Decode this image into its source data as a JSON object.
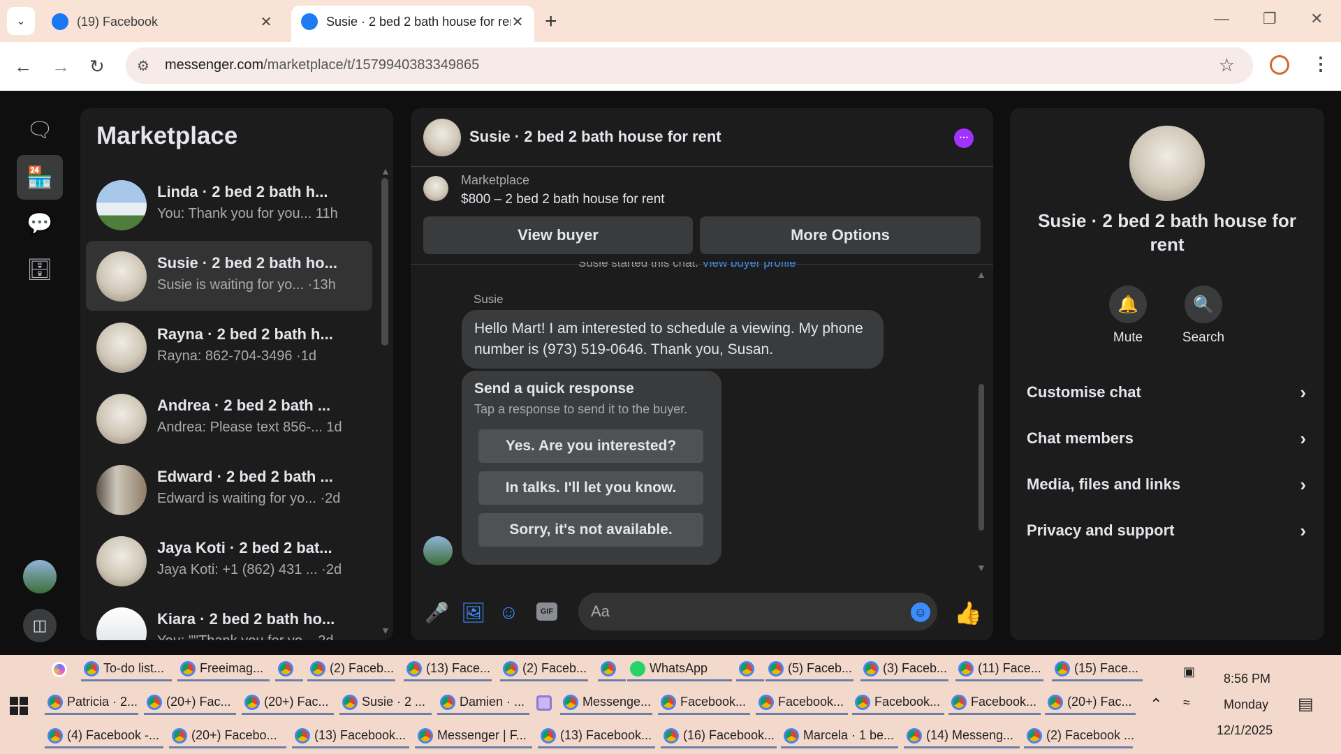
{
  "browser": {
    "tabs": [
      {
        "label": "(19) Facebook",
        "active": false
      },
      {
        "label": "Susie · 2 bed 2 bath house for rent",
        "active": true
      }
    ],
    "new_tab": "+",
    "url_domain": "messenger.com",
    "url_path": "/marketplace/t/1579940383349865"
  },
  "left": {
    "title": "Marketplace",
    "conversations": [
      {
        "name": "Linda · 2 bed 2 bath h...",
        "preview": "You: Thank you for you...",
        "time": "11h"
      },
      {
        "name": "Susie · 2 bed 2 bath ho...",
        "preview": "Susie is waiting for yo...",
        "time": "·13h"
      },
      {
        "name": "Rayna · 2 bed 2 bath h...",
        "preview": "Rayna: 862-704-3496",
        "time": "·1d"
      },
      {
        "name": "Andrea · 2 bed 2 bath ...",
        "preview": "Andrea: Please text 856-...",
        "time": "1d"
      },
      {
        "name": "Edward · 2 bed 2 bath ...",
        "preview": "Edward is waiting for yo...",
        "time": "·2d"
      },
      {
        "name": "Jaya Koti · 2 bed 2 bat...",
        "preview": "Jaya Koti: +1 (862) 431 ...",
        "time": "·2d"
      },
      {
        "name": "Kiara · 2 bed 2 bath ho...",
        "preview": "You: \"\"Thank you for yo...",
        "time": "2d"
      }
    ]
  },
  "chat": {
    "title": "Susie · 2 bed 2 bath house for rent",
    "marketplace_label": "Marketplace",
    "listing": "$800 – 2 bed 2 bath house for rent",
    "view_buyer": "View buyer",
    "more_options": "More Options",
    "started_text": "Susie started this chat.",
    "started_link": "View buyer profile",
    "sender": "Susie",
    "message": "Hello Mart! I am interested to schedule a viewing. My phone number is (973) 519-0646. Thank you, Susan.",
    "quick_title": "Send a quick response",
    "quick_sub": "Tap a response to send it to the buyer.",
    "quick_replies": [
      "Yes. Are you interested?",
      "In talks. I'll let you know.",
      "Sorry, it's not available."
    ],
    "input_placeholder": "Aa"
  },
  "details": {
    "title": "Susie · 2 bed 2 bath house for rent",
    "mute": "Mute",
    "search": "Search",
    "rows": [
      "Customise chat",
      "Chat members",
      "Media, files and links",
      "Privacy and support"
    ]
  },
  "taskbar": {
    "row1": [
      {
        "label": "To-do list...",
        "icon": "chrome"
      },
      {
        "label": "Freeimag...",
        "icon": "chrome"
      },
      {
        "label": "",
        "icon": "chrome"
      },
      {
        "label": "(2) Faceb...",
        "icon": "chrome"
      },
      {
        "label": "(13) Face...",
        "icon": "chrome"
      },
      {
        "label": "(2) Faceb...",
        "icon": "chrome"
      },
      {
        "label": "",
        "icon": "chrome"
      },
      {
        "label": "WhatsApp",
        "icon": "whatsapp"
      },
      {
        "label": "",
        "icon": "chrome"
      },
      {
        "label": "(5) Faceb...",
        "icon": "chrome"
      },
      {
        "label": "(3) Faceb...",
        "icon": "chrome"
      },
      {
        "label": "(11) Face...",
        "icon": "chrome"
      },
      {
        "label": "(15) Face...",
        "icon": "chrome"
      }
    ],
    "row2": [
      {
        "label": "Patricia · 2...",
        "icon": "chrome"
      },
      {
        "label": "(20+) Fac...",
        "icon": "chrome"
      },
      {
        "label": "(20+) Fac...",
        "icon": "chrome"
      },
      {
        "label": "Susie · 2 ...",
        "icon": "chrome"
      },
      {
        "label": "Damien · ...",
        "icon": "chrome"
      },
      {
        "label": "",
        "icon": "extension"
      },
      {
        "label": "Messenge...",
        "icon": "chrome"
      },
      {
        "label": "Facebook...",
        "icon": "chrome"
      },
      {
        "label": "Facebook...",
        "icon": "chrome"
      },
      {
        "label": "Facebook...",
        "icon": "chrome"
      },
      {
        "label": "Facebook...",
        "icon": "chrome"
      },
      {
        "label": "(20+) Fac...",
        "icon": "chrome"
      }
    ],
    "row3": [
      {
        "label": "(4) Facebook -...",
        "icon": "chrome"
      },
      {
        "label": "(20+) Facebo...",
        "icon": "chrome"
      },
      {
        "label": "(13) Facebook...",
        "icon": "chrome"
      },
      {
        "label": "Messenger | F...",
        "icon": "chrome"
      },
      {
        "label": "(13) Facebook...",
        "icon": "chrome"
      },
      {
        "label": "(16) Facebook...",
        "icon": "chrome"
      },
      {
        "label": "Marcela · 1 be...",
        "icon": "chrome"
      },
      {
        "label": "(14) Messeng...",
        "icon": "chrome"
      },
      {
        "label": "(2) Facebook ...",
        "icon": "chrome"
      }
    ],
    "time": "8:56 PM",
    "day": "Monday",
    "date": "12/1/2025"
  }
}
